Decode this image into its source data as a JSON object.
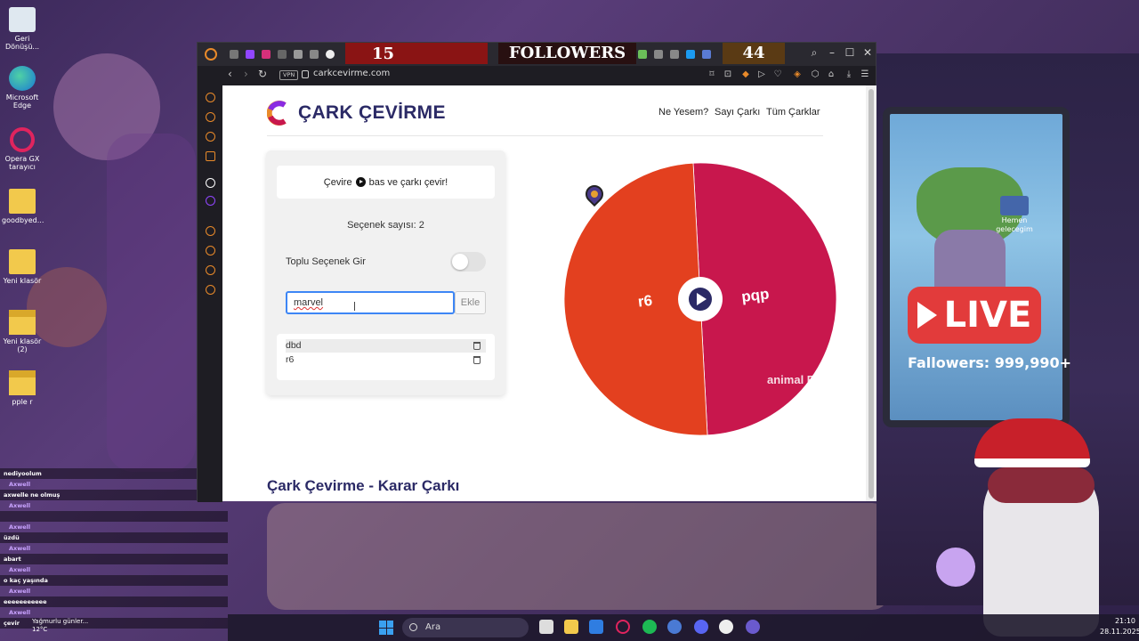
{
  "desktop": {
    "icons": [
      {
        "label": "Geri Dönüşü...",
        "icon": "recycle-bin-icon"
      },
      {
        "label": "Microsoft Edge",
        "icon": "edge-icon"
      },
      {
        "label": "Opera GX tarayıcı",
        "icon": "opera-gx-icon"
      },
      {
        "label": "goodbyed...",
        "icon": "folder-icon"
      },
      {
        "label": "Yeni klasör",
        "icon": "folder-icon"
      },
      {
        "label": "Yeni klasör (2)",
        "icon": "folder-icon"
      },
      {
        "label": "pple r",
        "icon": "folder-icon"
      }
    ],
    "shortcut_right": "Hemen gelecegim",
    "wallpaper": {
      "live_text": "LIVE",
      "followers_text": "Fallowers: 999,990+"
    }
  },
  "stream_overlay": {
    "counter_left": "15",
    "title": "FOLLOWERS",
    "counter_right": "44",
    "chat": [
      {
        "user": "",
        "msg": "nediyoolum"
      },
      {
        "user": "Axwell",
        "msg": "axwelle ne olmuş"
      },
      {
        "user": "Axwell",
        "msg": ""
      },
      {
        "user": "Axwell",
        "msg": "üzdü"
      },
      {
        "user": "Axwell",
        "msg": "abart"
      },
      {
        "user": "Axwell",
        "msg": "o kaç yaşında"
      },
      {
        "user": "Axwell",
        "msg": "eeeeeeeeeee"
      },
      {
        "user": "Axwell",
        "msg": "çevir"
      }
    ]
  },
  "browser": {
    "vpn_label": "VPN",
    "url": "carkcevirme.com",
    "accent": "#e98a2a"
  },
  "site": {
    "title": "ÇARK ÇEVİRME",
    "nav": [
      "Ne Yesem?",
      "Sayı Çarkı",
      "Tüm Çarklar"
    ],
    "hint_before": "Çevire",
    "hint_after": "bas ve çarkı çevir!",
    "option_count": "Seçenek sayısı: 2",
    "bulk_toggle_label": "Toplu Seçenek Gir",
    "bulk_toggle_on": false,
    "input_value": "marvel",
    "add_button": "Ekle",
    "options": [
      "dbd",
      "r6"
    ],
    "footer_heading": "Çark Çevirme - Karar Çarkı",
    "title_color": "#2b2a66"
  },
  "wheel": {
    "segments": [
      {
        "label": "pqp",
        "color": "#c8174d"
      },
      {
        "label": "r6",
        "color": "#e3401f"
      }
    ],
    "watermark": "animal F R"
  },
  "taskbar": {
    "search_label": "Ara",
    "weather": "Yağmurlu günler...",
    "temp": "12°C",
    "time": "21:10",
    "date": "28.11.2025"
  }
}
